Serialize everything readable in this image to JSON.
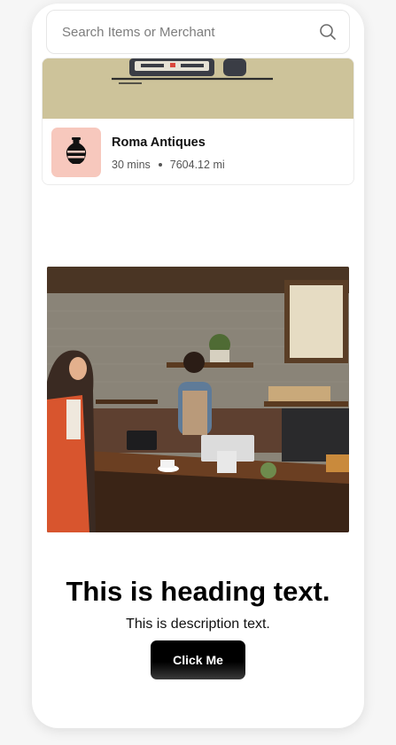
{
  "search": {
    "placeholder": "Search Items or Merchant",
    "icon": "search-icon"
  },
  "merchant": {
    "name": "Roma Antiques",
    "time": "30 mins",
    "distance": "7604.12 mi",
    "thumb_icon": "vase-icon",
    "thumb_color": "#f7c8bd",
    "banner_color": "#cdc39a"
  },
  "hero": {
    "image_subject": "coffee-shop-checkout-photo",
    "heading": "This is heading text.",
    "description": "This is description text.",
    "button_label": "Click Me"
  }
}
